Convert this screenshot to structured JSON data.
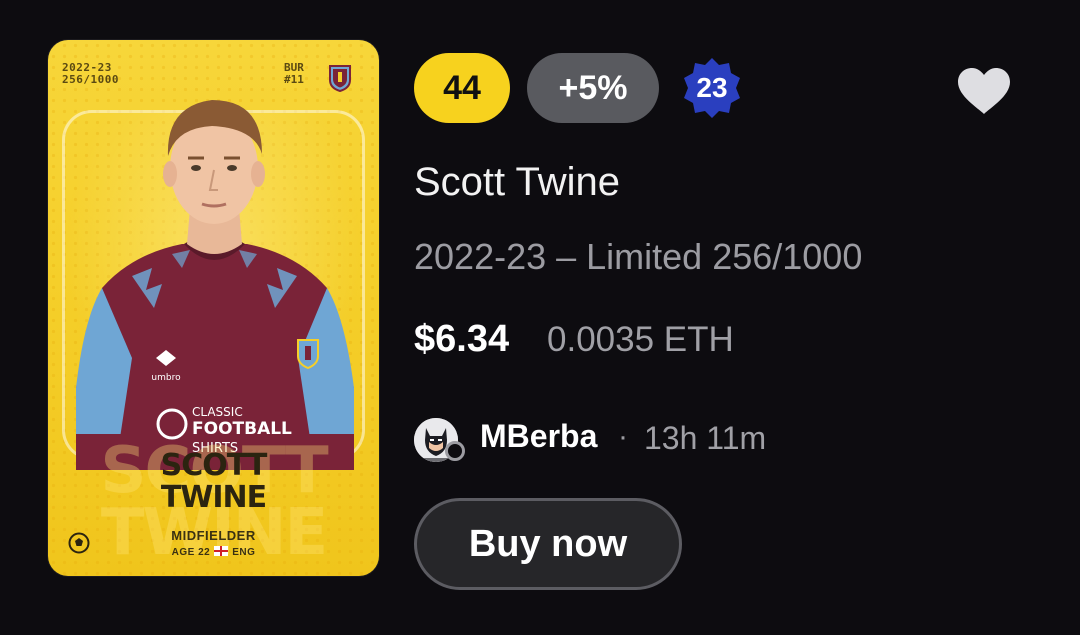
{
  "card": {
    "season_line1": "2022-23",
    "season_line2": "256/1000",
    "team_code": "BUR",
    "team_number": "#11",
    "name_line1": "SCOTT",
    "name_line2": "TWINE",
    "position": "MIDFIELDER",
    "age": "AGE 22",
    "nationality": "ENG",
    "shirt_sponsor_1": "CLASSIC",
    "shirt_sponsor_2": "FOOTBALL",
    "shirt_sponsor_3": "SHIRTS",
    "kit_brand": "umbro",
    "colors": {
      "card_bg": "#f5cf2a",
      "shirt_claret": "#7a2338",
      "shirt_sky": "#6fa6d4"
    }
  },
  "badges": {
    "score": "44",
    "trend": "+5%",
    "level": "23",
    "colors": {
      "score_bg": "#f7d21e",
      "trend_bg": "#595a5f",
      "level_bg": "#2a3fbf"
    }
  },
  "favorite": {
    "icon": "heart-icon"
  },
  "listing": {
    "player_name": "Scott Twine",
    "edition": "2022-23 – Limited 256/1000",
    "price_usd": "$6.34",
    "price_eth": "0.0035 ETH"
  },
  "seller": {
    "name": "MBerba",
    "separator": "·",
    "time_left": "13h 11m"
  },
  "actions": {
    "buy_label": "Buy now"
  }
}
